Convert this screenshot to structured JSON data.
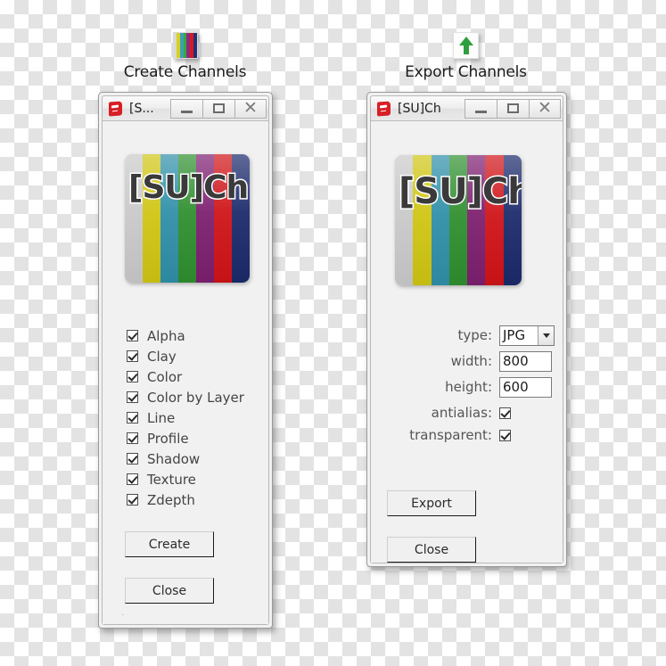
{
  "panels": {
    "create": {
      "caption": "Create Channels",
      "icon": "color-stripes-icon",
      "window": {
        "title": "[S...",
        "app_icon": "sketchup-icon",
        "minimize_label": "",
        "maximize_label": "",
        "close_label": "✕",
        "banner_text": "[SU]Ch",
        "checkboxes": [
          {
            "label": "Alpha",
            "checked": true
          },
          {
            "label": "Clay",
            "checked": true
          },
          {
            "label": "Color",
            "checked": true
          },
          {
            "label": "Color by Layer",
            "checked": true
          },
          {
            "label": "Line",
            "checked": true
          },
          {
            "label": "Profile",
            "checked": true
          },
          {
            "label": "Shadow",
            "checked": true
          },
          {
            "label": "Texture",
            "checked": true
          },
          {
            "label": "Zdepth",
            "checked": true
          }
        ],
        "create_button": "Create",
        "close_button": "Close"
      }
    },
    "export": {
      "caption": "Export Channels",
      "icon": "green-up-arrow-icon",
      "window": {
        "title": "[SU]Ch",
        "app_icon": "sketchup-icon",
        "minimize_label": "",
        "maximize_label": "",
        "close_label": "✕",
        "banner_text": "[SU]Ch",
        "fields": {
          "type_label": "type:",
          "type_value": "JPG",
          "type_options": [
            "JPG"
          ],
          "width_label": "width:",
          "width_value": "800",
          "height_label": "height:",
          "height_value": "600",
          "antialias_label": "antialias:",
          "antialias_checked": true,
          "transparent_label": "transparent:",
          "transparent_checked": true
        },
        "export_button": "Export",
        "close_button": "Close"
      }
    }
  },
  "banner_colors": [
    "#c9c9c9",
    "#cfc513",
    "#2f8fa8",
    "#2f8f2f",
    "#7d1f70",
    "#cf1317",
    "#1b2a6b"
  ],
  "icon_colors": [
    "#d8d8d8",
    "#d9d022",
    "#3aa0b8",
    "#3aa83a",
    "#8d2a80",
    "#d61a20",
    "#233178"
  ],
  "accent": {
    "export_arrow": "#2f9e3f",
    "sketchup_red": "#d81f26"
  }
}
